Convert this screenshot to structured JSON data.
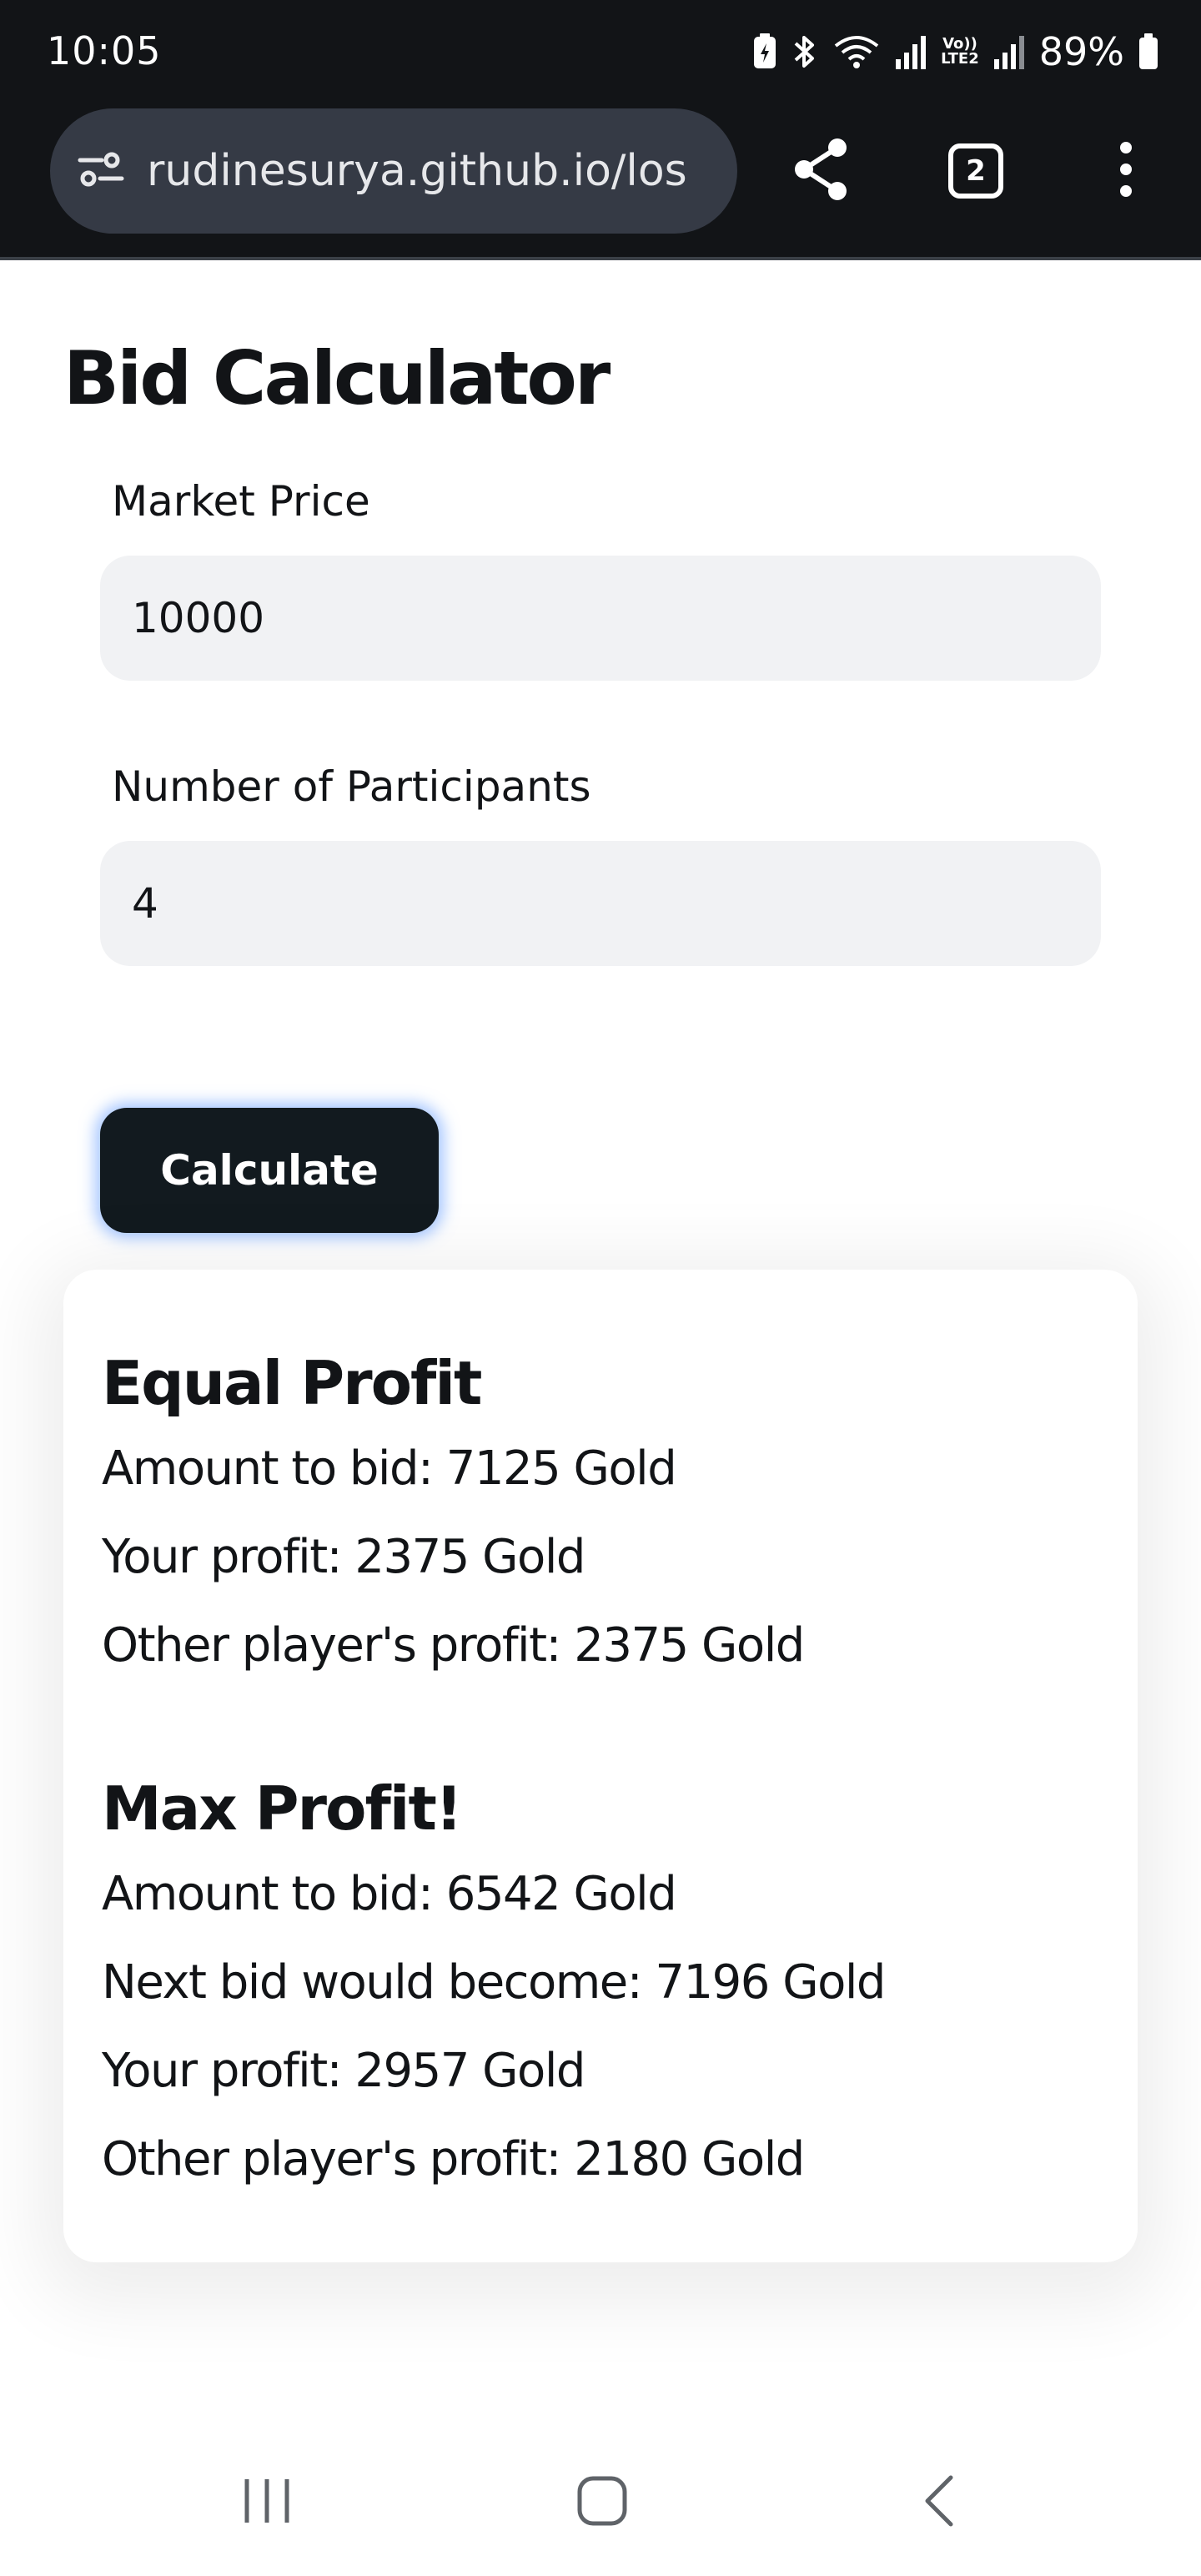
{
  "status_bar": {
    "time": "10:05",
    "battery_percent": "89%",
    "network_label_top": "Vo))",
    "network_label_bottom": "LTE2",
    "icons": [
      "battery-saver-icon",
      "bluetooth-icon",
      "wifi-icon",
      "signal-icon",
      "volte-icon",
      "signal-icon",
      "battery-icon"
    ]
  },
  "browser": {
    "url": "rudinesurya.github.io/los",
    "tab_count": "2",
    "icons": [
      "site-settings-icon",
      "share-icon",
      "tabs-icon",
      "more-vertical-icon"
    ]
  },
  "page": {
    "title": "Bid Calculator",
    "market_price": {
      "label": "Market Price",
      "value": "10000"
    },
    "participants": {
      "label": "Number of Participants",
      "value": "4"
    },
    "calculate_label": "Calculate"
  },
  "results": {
    "equal_profit": {
      "heading": "Equal Profit",
      "lines": [
        "Amount to bid: 7125 Gold",
        "Your profit: 2375 Gold",
        "Other player's profit: 2375 Gold"
      ]
    },
    "max_profit": {
      "heading": "Max Profit!",
      "lines": [
        "Amount to bid: 6542 Gold",
        "Next bid would become: 7196 Gold",
        "Your profit: 2957 Gold",
        "Other player's profit: 2180 Gold"
      ]
    }
  },
  "nav": {
    "icons": [
      "recents-icon",
      "home-icon",
      "back-icon"
    ]
  },
  "colors": {
    "status_bar_bg": "#121417",
    "url_pill_bg": "#353a45",
    "input_bg": "#f1f2f4",
    "button_bg": "#121a1f",
    "button_glow": "#5a96ff",
    "text": "#121417"
  }
}
